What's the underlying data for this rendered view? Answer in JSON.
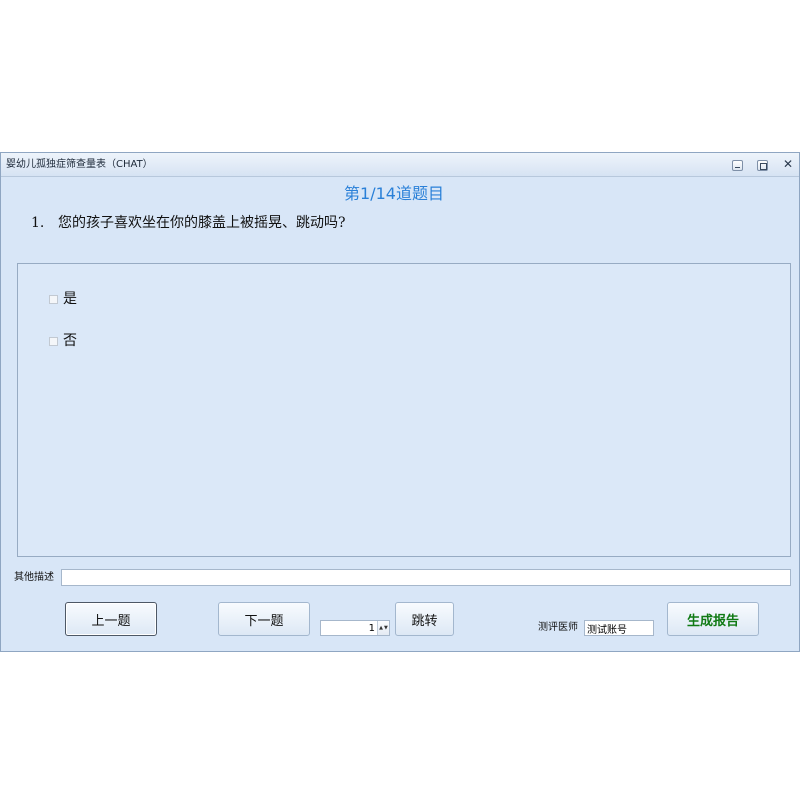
{
  "window": {
    "title": "婴幼儿孤独症筛查量表（CHAT）",
    "controls": {
      "minimize": "minimize-icon",
      "restore": "restore-icon",
      "close": "close-icon",
      "close_glyph": "✕"
    }
  },
  "question": {
    "progress": "第1/14道题目",
    "number": "1.",
    "text": "您的孩子喜欢坐在你的膝盖上被摇晃、跳动吗?",
    "options": [
      {
        "label": "是",
        "checked": false
      },
      {
        "label": "否",
        "checked": false
      }
    ]
  },
  "other": {
    "label": "其他描述",
    "value": ""
  },
  "toolbar": {
    "prev_label": "上一题",
    "next_label": "下一题",
    "jump_value": "1",
    "jump_label": "跳转",
    "doctor_label": "测评医师",
    "doctor_value": "测试账号",
    "report_label": "生成报告"
  },
  "icons": {
    "spin": "spin-updown-icon"
  },
  "colors": {
    "accent": "#2a80d8",
    "report": "#107a14",
    "background": "#d8e6f7"
  }
}
